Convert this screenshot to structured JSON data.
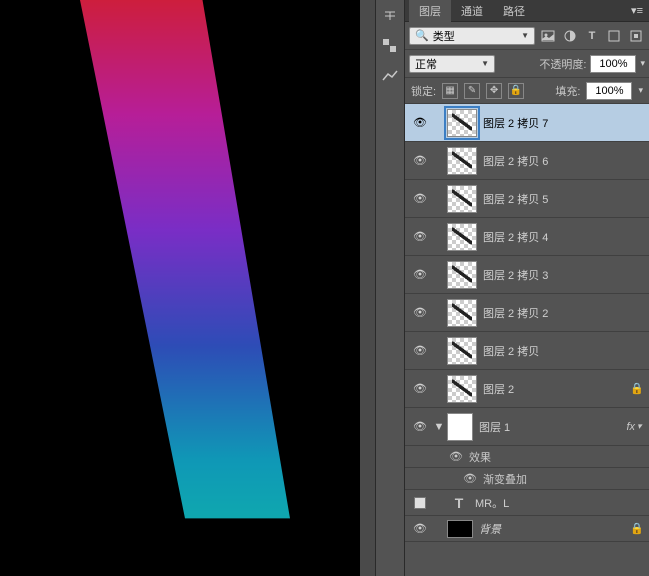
{
  "dock": {
    "history_icon": "history-icon",
    "adjust_icon": "adjust-icon"
  },
  "tabs": {
    "layers": "图层",
    "channels": "通道",
    "paths": "路径"
  },
  "filter_row": {
    "search_icon": "search-icon",
    "kind_label": "类型"
  },
  "blend_row": {
    "mode": "正常",
    "opacity_label": "不透明度:",
    "opacity_value": "100%"
  },
  "lock_row": {
    "lock_label": "锁定:",
    "fill_label": "填充:",
    "fill_value": "100%"
  },
  "layers": [
    {
      "name": "图层 2 拷贝 7",
      "thumb": "stroke",
      "selected": true,
      "locked": false
    },
    {
      "name": "图层 2 拷贝 6",
      "thumb": "stroke",
      "selected": false,
      "locked": false
    },
    {
      "name": "图层 2 拷贝 5",
      "thumb": "stroke",
      "selected": false,
      "locked": false
    },
    {
      "name": "图层 2 拷贝 4",
      "thumb": "stroke",
      "selected": false,
      "locked": false
    },
    {
      "name": "图层 2 拷贝 3",
      "thumb": "stroke",
      "selected": false,
      "locked": false
    },
    {
      "name": "图层 2 拷贝 2",
      "thumb": "stroke",
      "selected": false,
      "locked": false
    },
    {
      "name": "图层 2 拷贝",
      "thumb": "stroke",
      "selected": false,
      "locked": false
    },
    {
      "name": "图层 2",
      "thumb": "stroke",
      "selected": false,
      "locked": true
    },
    {
      "name": "图层 1",
      "thumb": "plain",
      "selected": false,
      "locked": false,
      "fx": true
    },
    {
      "name": "MR。L",
      "thumb": "text",
      "selected": false,
      "locked": false,
      "hidden": true
    },
    {
      "name": "背景",
      "thumb": "black",
      "selected": false,
      "locked": true
    }
  ],
  "effects": {
    "label": "效果",
    "items": [
      "渐变叠加"
    ]
  },
  "fx_label": "fx"
}
